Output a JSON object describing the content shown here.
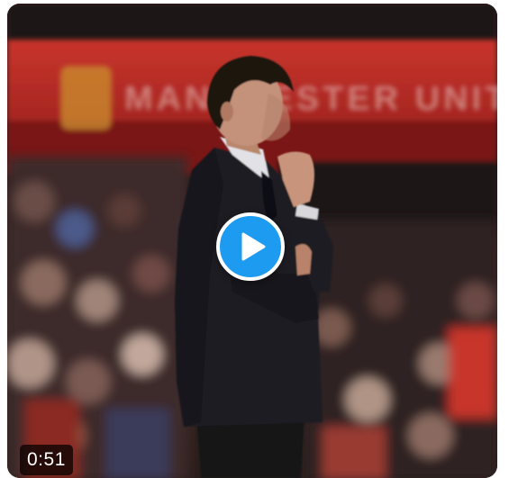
{
  "video": {
    "duration": "0:51",
    "play_icon": "play-icon",
    "accent_color": "#1d9bf0",
    "stadium_sign_text": "MANCHESTER UNITED"
  }
}
